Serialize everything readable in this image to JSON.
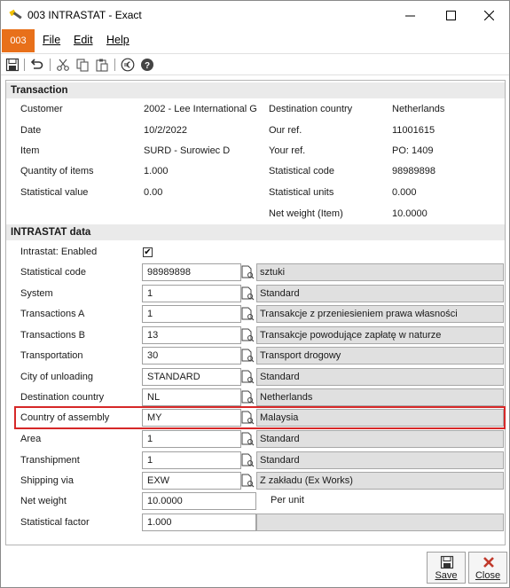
{
  "window": {
    "title": "003 INTRASTAT - Exact",
    "minimize": "—",
    "maximize": "☐",
    "close": "✕"
  },
  "menubar": {
    "badge": "003",
    "items": [
      "File",
      "Edit",
      "Help"
    ]
  },
  "toolbar": {
    "icons": [
      "save-icon",
      "undo-icon",
      "cut-icon",
      "copy-icon",
      "paste-icon",
      "euro-icon",
      "help-icon"
    ]
  },
  "transaction": {
    "header": "Transaction",
    "left": [
      {
        "label": "Customer",
        "value": "2002 - Lee International G"
      },
      {
        "label": "Date",
        "value": "10/2/2022"
      },
      {
        "label": "Item",
        "value": "SURD - Surowiec D"
      },
      {
        "label": "Quantity of items",
        "value": "1.000"
      },
      {
        "label": "Statistical value",
        "value": "0.00"
      }
    ],
    "right": [
      {
        "label": "Destination country",
        "value": "Netherlands"
      },
      {
        "label": "Our ref.",
        "value": "11001615"
      },
      {
        "label": "Your ref.",
        "value": "PO: 1409"
      },
      {
        "label": "Statistical code",
        "value": "98989898"
      },
      {
        "label": "Statistical units",
        "value": "0.000"
      },
      {
        "label": "Net weight (Item)",
        "value": "10.0000"
      }
    ]
  },
  "intrastat": {
    "header": "INTRASTAT data",
    "enabled_label": "Intrastat: Enabled",
    "enabled_checked": true,
    "check_mark": "✔",
    "rows": [
      {
        "label": "Statistical code",
        "value": "98989898",
        "desc": "sztuki"
      },
      {
        "label": "System",
        "value": "1",
        "desc": "Standard"
      },
      {
        "label": "Transactions A",
        "value": "1",
        "desc": "Transakcje z przeniesieniem prawa własności"
      },
      {
        "label": "Transactions B",
        "value": "13",
        "desc": "Transakcje powodujące zapłatę w naturze"
      },
      {
        "label": "Transportation",
        "value": "30",
        "desc": "Transport drogowy"
      },
      {
        "label": "City of unloading",
        "value": "STANDARD",
        "desc": "Standard"
      },
      {
        "label": "Destination country",
        "value": "NL",
        "desc": "Netherlands"
      },
      {
        "label": "Country of assembly",
        "value": "MY",
        "desc": "Malaysia"
      },
      {
        "label": "Area",
        "value": "1",
        "desc": "Standard"
      },
      {
        "label": "Transhipment",
        "value": "1",
        "desc": "Standard"
      },
      {
        "label": "Shipping via",
        "value": "EXW",
        "desc": "Z zakładu (Ex Works)"
      }
    ],
    "net_weight": {
      "label": "Net weight",
      "value": "10.0000",
      "unit": "Per unit"
    },
    "stat_factor": {
      "label": "Statistical factor",
      "value": "1.000",
      "desc": ""
    }
  },
  "buttons": {
    "save": "Save",
    "close": "Close"
  },
  "colors": {
    "accent": "#e8701a",
    "highlight": "#d62828",
    "close_button": "#c0392b"
  }
}
